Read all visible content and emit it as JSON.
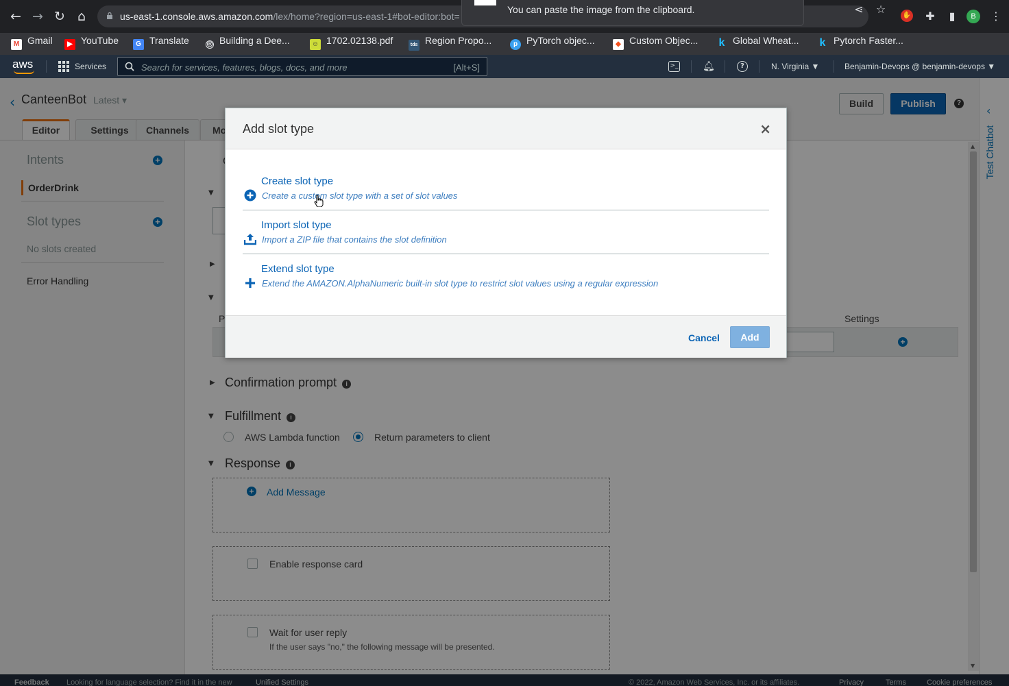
{
  "browser": {
    "url_host": "us-east-1.console.aws.amazon.com",
    "url_path": "/lex/home?region=us-east-1#bot-editor:bot=",
    "toast": "You can paste the image from the clipboard.",
    "profile_initial": "B",
    "bookmarks": [
      {
        "label": "Gmail",
        "icon": "gmail-icon",
        "color": "#ea4335"
      },
      {
        "label": "YouTube",
        "icon": "youtube-icon",
        "color": "#ff0000"
      },
      {
        "label": "Translate",
        "icon": "translate-icon",
        "color": "#4285f4"
      },
      {
        "label": "Building a Dee...",
        "icon": "site-icon",
        "color": "#5f6368"
      },
      {
        "label": "1702.02138.pdf",
        "icon": "pdf-icon",
        "color": "#7cb342"
      },
      {
        "label": "Region Propo...",
        "icon": "tds-icon",
        "color": "#355876"
      },
      {
        "label": "PyTorch objec...",
        "icon": "p-icon",
        "color": "#3aa0f0"
      },
      {
        "label": "Custom Objec...",
        "icon": "custom-icon",
        "color": "#f4511e"
      },
      {
        "label": "Global Wheat...",
        "icon": "kaggle-icon",
        "color": "#20beff"
      },
      {
        "label": "Pytorch Faster...",
        "icon": "kaggle-icon",
        "color": "#20beff"
      }
    ]
  },
  "aws_header": {
    "logo": "aws",
    "services": "Services",
    "search_placeholder": "Search for services, features, blogs, docs, and more",
    "search_shortcut": "[Alt+S]",
    "region": "N. Virginia ▼",
    "account": "Benjamin-Devops @ benjamin-devops ▼"
  },
  "page": {
    "bot_name": "CanteenBot",
    "version": "Latest ▾",
    "build_label": "Build",
    "publish_label": "Publish",
    "tabs": [
      {
        "label": "Editor"
      },
      {
        "label": "Settings"
      },
      {
        "label": "Channels"
      },
      {
        "label": "Mo"
      }
    ]
  },
  "sidebar": {
    "intents_heading": "Intents",
    "intent_item": "OrderDrink",
    "slot_types_heading": "Slot types",
    "no_slots": "No slots created",
    "error_handling": "Error Handling"
  },
  "main": {
    "slot_col_p": "P",
    "slot_col_settings": "Settings",
    "confirmation": "Confirmation prompt",
    "fulfillment": "Fulfillment",
    "lambda_option": "AWS Lambda function",
    "return_option": "Return parameters to client",
    "response": "Response",
    "add_message": "Add Message",
    "enable_card": "Enable response card",
    "wait_reply": "Wait for user reply",
    "wait_hint": "If the user says \"no,\" the following message will be presented."
  },
  "test_panel": {
    "label": "Test Chatbot"
  },
  "footer": {
    "feedback": "Feedback",
    "lang_note": "Looking for language selection? Find it in the new",
    "unified": "Unified Settings",
    "copyright": "© 2022, Amazon Web Services, Inc. or its affiliates.",
    "privacy": "Privacy",
    "terms": "Terms",
    "cookies": "Cookie preferences"
  },
  "modal": {
    "title": "Add slot type",
    "options": [
      {
        "title": "Create slot type",
        "desc": "Create a custom slot type with a set of slot values"
      },
      {
        "title": "Import slot type",
        "desc": "Import a ZIP file that contains the slot definition"
      },
      {
        "title": "Extend slot type",
        "desc": "Extend the AMAZON.AlphaNumeric built-in slot type to restrict slot values using a regular expression"
      }
    ],
    "cancel_label": "Cancel",
    "add_label": "Add"
  },
  "colors": {
    "aws_nav": "#232f3e",
    "link_blue": "#0b64b5",
    "accent_orange": "#ec7211"
  }
}
